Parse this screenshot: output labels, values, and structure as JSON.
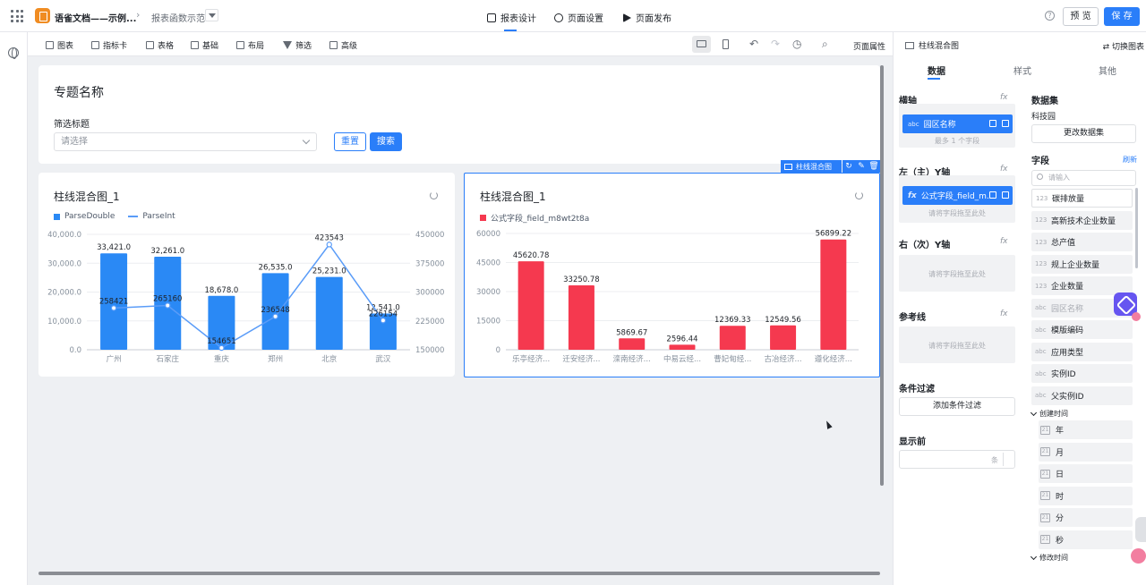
{
  "header": {
    "app_name": "语雀文档——示例...",
    "page_name": "报表函数示范",
    "tabs": [
      {
        "label": "报表设计"
      },
      {
        "label": "页面设置"
      },
      {
        "label": "页面发布"
      }
    ],
    "preview_label": "预 览",
    "save_label": "保 存",
    "help_glyph": "?"
  },
  "toolbar": {
    "items": [
      {
        "label": "图表",
        "icon": "chart-icon"
      },
      {
        "label": "指标卡",
        "icon": "metric-card-icon"
      },
      {
        "label": "表格",
        "icon": "table-icon"
      },
      {
        "label": "基础",
        "icon": "basic-icon"
      },
      {
        "label": "布局",
        "icon": "layout-icon"
      },
      {
        "label": "筛选",
        "icon": "filter-icon"
      },
      {
        "label": "高级",
        "icon": "advanced-icon"
      }
    ],
    "page_props_label": "页面属性"
  },
  "topic": {
    "title": "专题名称",
    "filter_label": "筛选标题",
    "select_placeholder": "请选择",
    "reset_label": "重置",
    "search_label": "搜索"
  },
  "chart_toolbar": {
    "tag_label": "柱线混合图"
  },
  "chart_data": [
    {
      "type": "bar+line",
      "title": "柱线混合图_1",
      "categories": [
        "广州",
        "石家庄",
        "重庆",
        "郑州",
        "北京",
        "武汉"
      ],
      "series": [
        {
          "name": "ParseDouble",
          "type": "bar",
          "axis": "left",
          "color": "#2a89f5",
          "values": [
            33421.0,
            32261.0,
            18678.0,
            26535.0,
            25231.0,
            12541.0
          ],
          "labels": [
            "33,421.0",
            "32,261.0",
            "18,678.0",
            "26,535.0",
            "25,231.0",
            "12,541.0"
          ]
        },
        {
          "name": "ParseInt",
          "type": "line",
          "axis": "right",
          "color": "#5a9cf8",
          "values": [
            258421,
            265160,
            154651,
            236548,
            423543,
            226154
          ],
          "labels": [
            "258421",
            "265160",
            "154651",
            "236548",
            "423543",
            "226154"
          ]
        }
      ],
      "y_left": {
        "min": 0,
        "max": 40000,
        "ticks": [
          "0.0",
          "10,000.0",
          "20,000.0",
          "30,000.0",
          "40,000.0"
        ]
      },
      "y_right": {
        "min": 150000,
        "max": 450000,
        "ticks": [
          "150000",
          "225000",
          "300000",
          "375000",
          "450000"
        ]
      },
      "legend": "top-left",
      "grid": true
    },
    {
      "type": "bar",
      "title": "柱线混合图_1",
      "categories": [
        "乐亭经济...",
        "迁安经济...",
        "滦南经济...",
        "中易云经...",
        "曹妃甸经...",
        "古冶经济...",
        "遵化经济..."
      ],
      "series": [
        {
          "name": "公式字段_field_m8wt2t8a",
          "type": "bar",
          "axis": "left",
          "color": "#f5394f",
          "values": [
            45620.78,
            33250.78,
            5869.67,
            2596.44,
            12369.33,
            12549.56,
            56899.22
          ],
          "labels": [
            "45620.78",
            "33250.78",
            "5869.67",
            "2596.44",
            "12369.33",
            "12549.56",
            "56899.22"
          ]
        }
      ],
      "y_left": {
        "min": 0,
        "max": 60000,
        "ticks": [
          "0",
          "15000",
          "30000",
          "45000",
          "60000"
        ]
      },
      "legend": "top-left",
      "grid": true
    }
  ],
  "config": {
    "header_label": "柱线混合图",
    "switch_label": "切换图表",
    "tabs": [
      {
        "label": "数据"
      },
      {
        "label": "样式"
      },
      {
        "label": "其他"
      }
    ],
    "fx_glyph": "fx",
    "x_axis": {
      "label": "横轴",
      "pill_type": "abc",
      "pill_text": "园区名称",
      "hint": "最多 1 个字段"
    },
    "y_left": {
      "label": "左（主）Y轴",
      "pill_type": "fx",
      "pill_text": "公式字段_field_m...",
      "hint": "请将字段拖至此处"
    },
    "y_right": {
      "label": "右（次）Y轴",
      "hint": "请将字段拖至此处"
    },
    "reference": {
      "label": "参考线",
      "hint": "请将字段拖至此处"
    },
    "condition": {
      "label": "条件过滤",
      "add_label": "添加条件过滤"
    },
    "show_top": {
      "label": "显示前",
      "unit": "条"
    },
    "dataset": {
      "label": "数据集",
      "name": "科技园",
      "change_label": "更改数据集"
    },
    "fields": {
      "label": "字段",
      "refresh_label": "刷新",
      "search_placeholder": "请输入",
      "items": [
        {
          "type": "123",
          "name": "碳排放量"
        },
        {
          "type": "123",
          "name": "高新技术企业数量"
        },
        {
          "type": "123",
          "name": "总产值"
        },
        {
          "type": "123",
          "name": "规上企业数量"
        },
        {
          "type": "123",
          "name": "企业数量"
        },
        {
          "type": "abc",
          "name": "园区名称"
        },
        {
          "type": "abc",
          "name": "模版编码"
        },
        {
          "type": "abc",
          "name": "应用类型"
        },
        {
          "type": "abc",
          "name": "实例ID"
        },
        {
          "type": "abc",
          "name": "父实例ID"
        }
      ],
      "created_group": {
        "label": "创建时间",
        "items": [
          "年",
          "月",
          "日",
          "时",
          "分",
          "秒"
        ]
      },
      "modified_group": {
        "label": "修改时间"
      }
    }
  }
}
